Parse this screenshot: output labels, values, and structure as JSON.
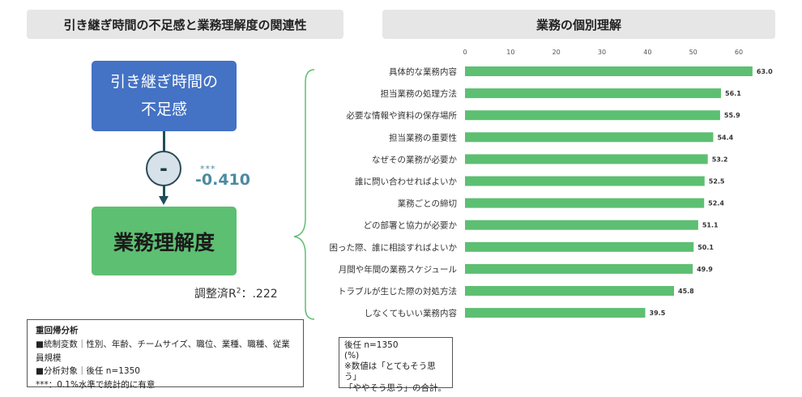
{
  "headers": {
    "left": "引き継ぎ時間の不足感と業務理解度の関連性",
    "right": "業務の個別理解"
  },
  "diagram": {
    "source_box": "引き継ぎ時間の不足感",
    "target_box": "業務理解度",
    "effect_sign": "-",
    "significance": "***",
    "coefficient": "-0.410",
    "r2_prefix": "調整済R",
    "r2_sup": "2",
    "r2_value": "：.222"
  },
  "notes_left": {
    "title": "重回帰分析",
    "line1": "■統制変数｜性別、年齢、チームサイズ、職位、業種、職種、従業員規模",
    "line2": "■分析対象｜後任 n=1350",
    "line3": "***：0.1%水準で統計的に有意"
  },
  "notes_right": {
    "line1": "後任 n=1350",
    "line2": "(%)",
    "line3": "※数値は「とてもそう思う」",
    "line4": "「ややそう思う」の合計。"
  },
  "colors": {
    "bar": "#5dbf72",
    "blue_box": "#4472c4",
    "green_box": "#5dbf72",
    "coefficient_text": "#4c8aa0",
    "brace": "#5dbf72"
  },
  "chart_data": {
    "type": "bar",
    "orientation": "horizontal",
    "title": "業務の個別理解",
    "categories": [
      "具体的な業務内容",
      "担当業務の処理方法",
      "必要な情報や資料の保存場所",
      "担当業務の重要性",
      "なぜその業務が必要か",
      "誰に問い合わせればよいか",
      "業務ごとの締切",
      "どの部署と協力が必要か",
      "困った際、誰に相談すればよいか",
      "月間や年間の業務スケジュール",
      "トラブルが生じた際の対処方法",
      "しなくてもいい業務内容"
    ],
    "values": [
      63.0,
      56.1,
      55.9,
      54.4,
      53.2,
      52.5,
      52.4,
      51.1,
      50.1,
      49.9,
      45.8,
      39.5
    ],
    "value_labels": [
      "63.0",
      "56.1",
      "55.9",
      "54.4",
      "53.2",
      "52.5",
      "52.4",
      "51.1",
      "50.1",
      "49.9",
      "45.8",
      "39.5"
    ],
    "xlim": [
      0,
      70
    ],
    "xticks": [
      0,
      10,
      20,
      30,
      40,
      50,
      60
    ],
    "grid": false,
    "unit": "(%)"
  }
}
